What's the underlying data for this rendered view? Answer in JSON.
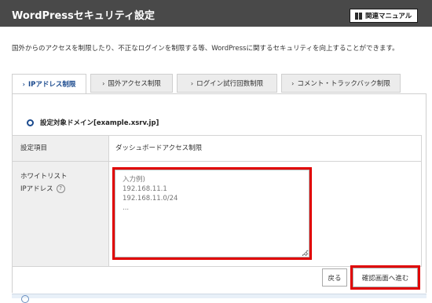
{
  "header": {
    "title": "WordPressセキュリティ設定",
    "manual_label": "関連マニュアル"
  },
  "description": "国外からのアクセスを制限したり、不正なログインを制限する等、WordPressに関するセキュリティを向上することができます。",
  "tabs": [
    {
      "label": "IPアドレス制限",
      "active": true
    },
    {
      "label": "国外アクセス制限",
      "active": false
    },
    {
      "label": "ログイン試行回数制限",
      "active": false
    },
    {
      "label": "コメント・トラックバック制限",
      "active": false
    }
  ],
  "domain": {
    "label": "設定対象ドメイン[example.xsrv.jp]"
  },
  "table": {
    "setting_item_label": "設定項目",
    "setting_item_value": "ダッシュボードアクセス制限",
    "whitelist_label_line1": "ホワイトリスト",
    "whitelist_label_line2": "IPアドレス",
    "help_glyph": "?"
  },
  "whitelist": {
    "placeholder": "入力例)\n192.168.11.1\n192.168.11.0/24\n..."
  },
  "buttons": {
    "back_label": "戻る",
    "confirm_label": "確認画面へ進む"
  },
  "colors": {
    "header_bg": "#494949",
    "accent": "#1b4a8e",
    "highlight": "#e00000"
  }
}
